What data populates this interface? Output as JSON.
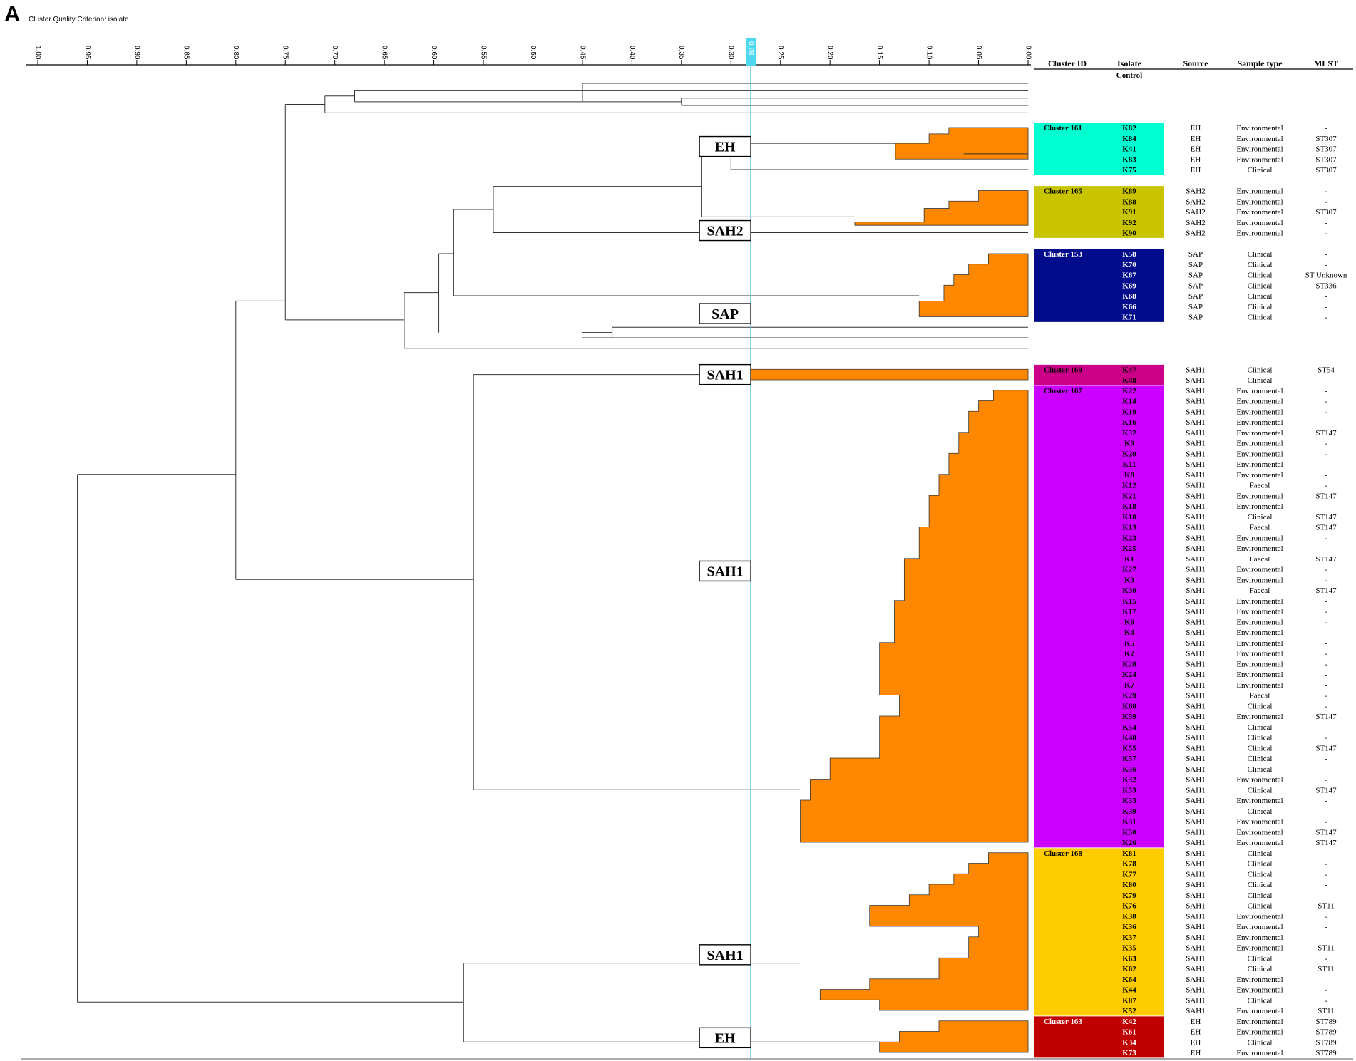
{
  "panel_label": "A",
  "criterion_label": "Cluster Quality Criterion: isolate",
  "axis": {
    "ticks": [
      "1.00",
      "0.95",
      "0.90",
      "0.85",
      "0.80",
      "0.75",
      "0.70",
      "0.65",
      "0.60",
      "0.55",
      "0.50",
      "0.45",
      "0.40",
      "0.35",
      "0.30",
      "0.25",
      "0.20",
      "0.15",
      "0.10",
      "0.05",
      "0.00"
    ],
    "cutoff_label": "0.28",
    "cutoff_value": 0.28
  },
  "table_headers": {
    "cluster_id": "Cluster ID",
    "isolate": "Isolate",
    "source": "Source",
    "sample_type": "Sample type",
    "mlst": "MLST"
  },
  "colors": {
    "orange": "#FF8800",
    "cutoff_line": "#5BC0EB",
    "cutoff_box": "#4DD8F0",
    "c161": "#00FFD0",
    "c165": "#C8C400",
    "c153": "#000C8C",
    "c169": "#CC0088",
    "c167": "#CC00FF",
    "c168": "#FFCC00",
    "c163": "#C00000"
  },
  "control_row": {
    "isolate": "Control"
  },
  "clusters": [
    {
      "id": "Cluster 161",
      "color": "c161",
      "text_color": "#000000",
      "rows": [
        {
          "isolate": "K82",
          "source": "EH",
          "sample": "Environmental",
          "mlst": "-"
        },
        {
          "isolate": "K84",
          "source": "EH",
          "sample": "Environmental",
          "mlst": "ST307"
        },
        {
          "isolate": "K41",
          "source": "EH",
          "sample": "Environmental",
          "mlst": "ST307"
        },
        {
          "isolate": "K83",
          "source": "EH",
          "sample": "Environmental",
          "mlst": "ST307"
        },
        {
          "isolate": "K75",
          "source": "EH",
          "sample": "Clinical",
          "mlst": "ST307"
        }
      ]
    },
    {
      "id": "Cluster 165",
      "color": "c165",
      "text_color": "#000000",
      "rows": [
        {
          "isolate": "K89",
          "source": "SAH2",
          "sample": "Environmental",
          "mlst": "-"
        },
        {
          "isolate": "K88",
          "source": "SAH2",
          "sample": "Environmental",
          "mlst": "-"
        },
        {
          "isolate": "K91",
          "source": "SAH2",
          "sample": "Environmental",
          "mlst": "ST307"
        },
        {
          "isolate": "K92",
          "source": "SAH2",
          "sample": "Environmental",
          "mlst": "-"
        },
        {
          "isolate": "K90",
          "source": "SAH2",
          "sample": "Environmental",
          "mlst": "-"
        }
      ]
    },
    {
      "id": "Cluster 153",
      "color": "c153",
      "text_color": "#ffffff",
      "rows": [
        {
          "isolate": "K58",
          "source": "SAP",
          "sample": "Clinical",
          "mlst": "-"
        },
        {
          "isolate": "K70",
          "source": "SAP",
          "sample": "Clinical",
          "mlst": "-"
        },
        {
          "isolate": "K67",
          "source": "SAP",
          "sample": "Clinical",
          "mlst": "ST Unknown"
        },
        {
          "isolate": "K69",
          "source": "SAP",
          "sample": "Clinical",
          "mlst": "ST336"
        },
        {
          "isolate": "K68",
          "source": "SAP",
          "sample": "Clinical",
          "mlst": "-"
        },
        {
          "isolate": "K66",
          "source": "SAP",
          "sample": "Clinical",
          "mlst": "-"
        },
        {
          "isolate": "K71",
          "source": "SAP",
          "sample": "Clinical",
          "mlst": "-"
        }
      ]
    },
    {
      "id": "Cluster 169",
      "color": "c169",
      "text_color": "#000000",
      "rows": [
        {
          "isolate": "K47",
          "source": "SAH1",
          "sample": "Clinical",
          "mlst": "ST54"
        },
        {
          "isolate": "K48",
          "source": "SAH1",
          "sample": "Clinical",
          "mlst": "-"
        }
      ]
    },
    {
      "id": "Cluster 167",
      "color": "c167",
      "text_color": "#000000",
      "rows": [
        {
          "isolate": "K22",
          "source": "SAH1",
          "sample": "Environmental",
          "mlst": "-"
        },
        {
          "isolate": "K14",
          "source": "SAH1",
          "sample": "Environmental",
          "mlst": "-"
        },
        {
          "isolate": "K19",
          "source": "SAH1",
          "sample": "Environmental",
          "mlst": "-"
        },
        {
          "isolate": "K16",
          "source": "SAH1",
          "sample": "Environmental",
          "mlst": "-"
        },
        {
          "isolate": "K32",
          "source": "SAH1",
          "sample": "Environmental",
          "mlst": "ST147"
        },
        {
          "isolate": "K9",
          "source": "SAH1",
          "sample": "Environmental",
          "mlst": "-"
        },
        {
          "isolate": "K20",
          "source": "SAH1",
          "sample": "Environmental",
          "mlst": "-"
        },
        {
          "isolate": "K11",
          "source": "SAH1",
          "sample": "Environmental",
          "mlst": "-"
        },
        {
          "isolate": "K8",
          "source": "SAH1",
          "sample": "Environmental",
          "mlst": "-"
        },
        {
          "isolate": "K12",
          "source": "SAH1",
          "sample": "Faecal",
          "mlst": "-"
        },
        {
          "isolate": "K21",
          "source": "SAH1",
          "sample": "Environmental",
          "mlst": "ST147"
        },
        {
          "isolate": "K18",
          "source": "SAH1",
          "sample": "Environmental",
          "mlst": "-"
        },
        {
          "isolate": "K10",
          "source": "SAH1",
          "sample": "Clinical",
          "mlst": "ST147"
        },
        {
          "isolate": "K13",
          "source": "SAH1",
          "sample": "Faecal",
          "mlst": "ST147"
        },
        {
          "isolate": "K23",
          "source": "SAH1",
          "sample": "Environmental",
          "mlst": "-"
        },
        {
          "isolate": "K25",
          "source": "SAH1",
          "sample": "Environmental",
          "mlst": "-"
        },
        {
          "isolate": "K1",
          "source": "SAH1",
          "sample": "Faecal",
          "mlst": "ST147"
        },
        {
          "isolate": "K27",
          "source": "SAH1",
          "sample": "Environmental",
          "mlst": "-"
        },
        {
          "isolate": "K3",
          "source": "SAH1",
          "sample": "Environmental",
          "mlst": "-"
        },
        {
          "isolate": "K30",
          "source": "SAH1",
          "sample": "Faecal",
          "mlst": "ST147"
        },
        {
          "isolate": "K15",
          "source": "SAH1",
          "sample": "Environmental",
          "mlst": "-"
        },
        {
          "isolate": "K17",
          "source": "SAH1",
          "sample": "Environmental",
          "mlst": "-"
        },
        {
          "isolate": "K6",
          "source": "SAH1",
          "sample": "Environmental",
          "mlst": "-"
        },
        {
          "isolate": "K4",
          "source": "SAH1",
          "sample": "Environmental",
          "mlst": "-"
        },
        {
          "isolate": "K5",
          "source": "SAH1",
          "sample": "Environmental",
          "mlst": "-"
        },
        {
          "isolate": "K2",
          "source": "SAH1",
          "sample": "Environmental",
          "mlst": "-"
        },
        {
          "isolate": "K28",
          "source": "SAH1",
          "sample": "Environmental",
          "mlst": "-"
        },
        {
          "isolate": "K24",
          "source": "SAH1",
          "sample": "Environmental",
          "mlst": "-"
        },
        {
          "isolate": "K7",
          "source": "SAH1",
          "sample": "Environmental",
          "mlst": "-"
        },
        {
          "isolate": "K29",
          "source": "SAH1",
          "sample": "Faecal",
          "mlst": "-"
        },
        {
          "isolate": "K60",
          "source": "SAH1",
          "sample": "Clinical",
          "mlst": "-"
        },
        {
          "isolate": "K59",
          "source": "SAH1",
          "sample": "Environmental",
          "mlst": "ST147"
        },
        {
          "isolate": "K54",
          "source": "SAH1",
          "sample": "Clinical",
          "mlst": "-"
        },
        {
          "isolate": "K40",
          "source": "SAH1",
          "sample": "Clinical",
          "mlst": "-"
        },
        {
          "isolate": "K55",
          "source": "SAH1",
          "sample": "Clinical",
          "mlst": "ST147"
        },
        {
          "isolate": "K57",
          "source": "SAH1",
          "sample": "Clinical",
          "mlst": "-"
        },
        {
          "isolate": "K56",
          "source": "SAH1",
          "sample": "Clinical",
          "mlst": "-"
        },
        {
          "isolate": "K32",
          "source": "SAH1",
          "sample": "Environmental",
          "mlst": "-"
        },
        {
          "isolate": "K53",
          "source": "SAH1",
          "sample": "Clinical",
          "mlst": "ST147"
        },
        {
          "isolate": "K33",
          "source": "SAH1",
          "sample": "Environmental",
          "mlst": "-"
        },
        {
          "isolate": "K39",
          "source": "SAH1",
          "sample": "Clinical",
          "mlst": "-"
        },
        {
          "isolate": "K31",
          "source": "SAH1",
          "sample": "Environmental",
          "mlst": "-"
        },
        {
          "isolate": "K50",
          "source": "SAH1",
          "sample": "Environmental",
          "mlst": "ST147"
        },
        {
          "isolate": "K26",
          "source": "SAH1",
          "sample": "Environmental",
          "mlst": "ST147"
        }
      ]
    },
    {
      "id": "Cluster 168",
      "color": "c168",
      "text_color": "#000000",
      "rows": [
        {
          "isolate": "K81",
          "source": "SAH1",
          "sample": "Clinical",
          "mlst": "-"
        },
        {
          "isolate": "K78",
          "source": "SAH1",
          "sample": "Clinical",
          "mlst": "-"
        },
        {
          "isolate": "K77",
          "source": "SAH1",
          "sample": "Clinical",
          "mlst": "-"
        },
        {
          "isolate": "K80",
          "source": "SAH1",
          "sample": "Clinical",
          "mlst": "-"
        },
        {
          "isolate": "K79",
          "source": "SAH1",
          "sample": "Clinical",
          "mlst": "-"
        },
        {
          "isolate": "K76",
          "source": "SAH1",
          "sample": "Clinical",
          "mlst": "ST11"
        },
        {
          "isolate": "K38",
          "source": "SAH1",
          "sample": "Environmental",
          "mlst": "-"
        },
        {
          "isolate": "K36",
          "source": "SAH1",
          "sample": "Environmental",
          "mlst": "-"
        },
        {
          "isolate": "K37",
          "source": "SAH1",
          "sample": "Environmental",
          "mlst": "-"
        },
        {
          "isolate": "K35",
          "source": "SAH1",
          "sample": "Environmental",
          "mlst": "ST11"
        },
        {
          "isolate": "K63",
          "source": "SAH1",
          "sample": "Clinical",
          "mlst": "-"
        },
        {
          "isolate": "K62",
          "source": "SAH1",
          "sample": "Clinical",
          "mlst": "ST11"
        },
        {
          "isolate": "K64",
          "source": "SAH1",
          "sample": "Environmental",
          "mlst": "-"
        },
        {
          "isolate": "K44",
          "source": "SAH1",
          "sample": "Environmental",
          "mlst": "-"
        },
        {
          "isolate": "K87",
          "source": "SAH1",
          "sample": "Clinical",
          "mlst": "-"
        },
        {
          "isolate": "K52",
          "source": "SAH1",
          "sample": "Environmental",
          "mlst": "ST11"
        }
      ]
    },
    {
      "id": "Cluster 163",
      "color": "c163",
      "text_color": "#ffffff",
      "rows": [
        {
          "isolate": "K42",
          "source": "EH",
          "sample": "Environmental",
          "mlst": "ST789"
        },
        {
          "isolate": "K61",
          "source": "EH",
          "sample": "Environmental",
          "mlst": "ST789"
        },
        {
          "isolate": "K34",
          "source": "EH",
          "sample": "Clinical",
          "mlst": "ST789"
        },
        {
          "isolate": "K73",
          "source": "EH",
          "sample": "Environmental",
          "mlst": "ST789"
        }
      ]
    }
  ],
  "group_labels": [
    "EH",
    "SAH2",
    "SAP",
    "SAH1",
    "SAH1",
    "SAH1",
    "EH"
  ]
}
